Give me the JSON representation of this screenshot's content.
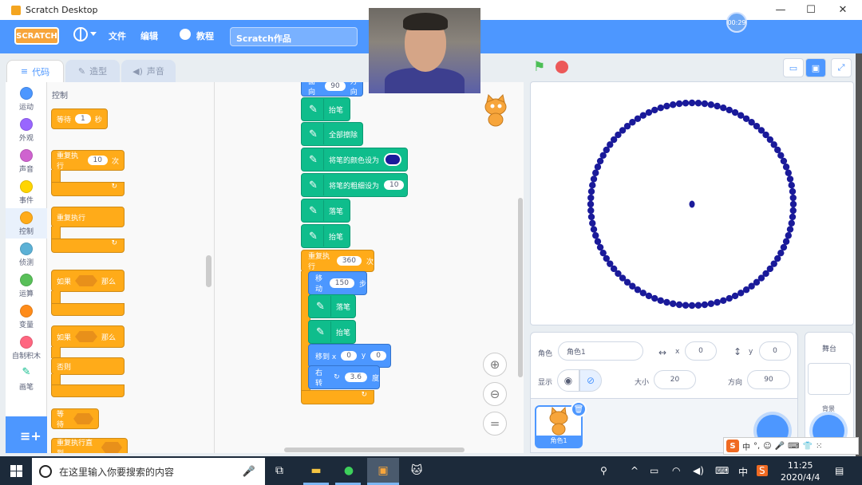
{
  "window": {
    "title": "Scratch Desktop",
    "minimize": "—",
    "maximize": "☐",
    "close": "✕"
  },
  "menubar": {
    "logo": "SCRATCH",
    "file": "文件",
    "edit": "编辑",
    "tutorials": "教程",
    "project_title": "Scratch作品",
    "timer": "00:29"
  },
  "tabs": {
    "code": "代码",
    "costumes": "造型",
    "sounds": "声音"
  },
  "categories": [
    {
      "label": "运动",
      "color": "#4c97ff"
    },
    {
      "label": "外观",
      "color": "#9966ff"
    },
    {
      "label": "声音",
      "color": "#cf63cf"
    },
    {
      "label": "事件",
      "color": "#ffd500"
    },
    {
      "label": "控制",
      "color": "#ffab19"
    },
    {
      "label": "侦测",
      "color": "#5cb1d6"
    },
    {
      "label": "运算",
      "color": "#59c059"
    },
    {
      "label": "变量",
      "color": "#ff8c1a"
    },
    {
      "label": "自制积木",
      "color": "#ff6680"
    },
    {
      "label": "画笔",
      "color": "#0fbd8c"
    }
  ],
  "palette": {
    "title": "控制",
    "wait": {
      "prefix": "等待",
      "value": "1",
      "suffix": "秒"
    },
    "repeat": {
      "prefix": "重复执行",
      "value": "10",
      "suffix": "次"
    },
    "forever": "重复执行",
    "if_then": {
      "prefix": "如果",
      "suffix": "那么"
    },
    "if_else": {
      "prefix": "如果",
      "suffix": "那么",
      "else": "否则"
    },
    "wait_until": "等待",
    "repeat_until": "重复执行直到"
  },
  "script": {
    "point_dir": {
      "prefix": "面向",
      "value": "90",
      "suffix": "方向"
    },
    "pen_up_1": "抬笔",
    "erase_all": "全部擦除",
    "set_color": "将笔的颜色设为",
    "set_size": {
      "label": "将笔的粗细设为",
      "value": "10"
    },
    "pen_down_1": "落笔",
    "pen_up_2": "抬笔",
    "repeat": {
      "prefix": "重复执行",
      "value": "360",
      "suffix": "次"
    },
    "move": {
      "prefix": "移动",
      "value": "150",
      "suffix": "步"
    },
    "pen_down_2": "落笔",
    "pen_up_3": "抬笔",
    "goto": {
      "prefix": "移到 x",
      "x": "0",
      "y_label": "y",
      "y": "0"
    },
    "turn": {
      "prefix": "右转",
      "value": "3.6",
      "suffix": "度"
    },
    "pen_color": "#1a1a9a"
  },
  "stage": {
    "dot_count": 100,
    "dot_color": "#1a1a9a"
  },
  "sprite_info": {
    "sprite_label": "角色",
    "sprite_name": "角色1",
    "x_label": "x",
    "x": "0",
    "y_label": "y",
    "y": "0",
    "show_label": "显示",
    "size_label": "大小",
    "size": "20",
    "direction_label": "方向",
    "direction": "90"
  },
  "sprite_list": [
    {
      "name": "角色1"
    }
  ],
  "stage_panel": {
    "title": "舞台",
    "backdrops": "背景"
  },
  "ime": {
    "mode": "中"
  },
  "taskbar": {
    "search_placeholder": "在这里输入你要搜索的内容",
    "time": "11:25",
    "date": "2020/4/4",
    "ime": "中"
  }
}
